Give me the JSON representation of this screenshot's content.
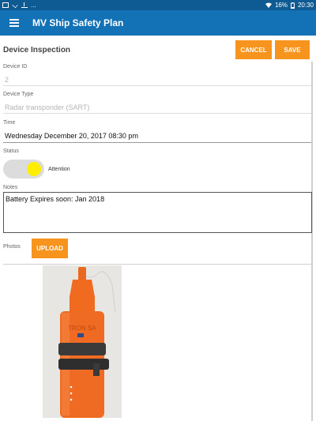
{
  "status_bar": {
    "left_icons": [
      "image-icon",
      "check-icon",
      "download-icon"
    ],
    "ellipsis": "...",
    "battery": "16%",
    "time": "20:30"
  },
  "app_bar": {
    "title": "MV Ship Safety Plan",
    "color": "#1372b5"
  },
  "page": {
    "title": "Device Inspection",
    "cancel_label": "CANCEL",
    "save_label": "SAVE",
    "accent": "#f7941d"
  },
  "form": {
    "device_id": {
      "label": "Device ID",
      "value": "2"
    },
    "device_type": {
      "label": "Device Type",
      "value": "Radar transponder (SART)"
    },
    "time": {
      "label": "Time",
      "value": "Wednesday December 20, 2017 08:30 pm"
    },
    "status": {
      "label": "Status",
      "toggle_state": "on",
      "state_label": "Attention",
      "knob_color": "#ffee00"
    },
    "notes": {
      "label": "Notes",
      "value": "Battery Expires soon: Jan 2018"
    },
    "photos": {
      "label": "Photos",
      "upload_label": "UPLOAD"
    }
  },
  "photo": {
    "subject": "orange SART device",
    "text_on_device": "TRON SA"
  }
}
